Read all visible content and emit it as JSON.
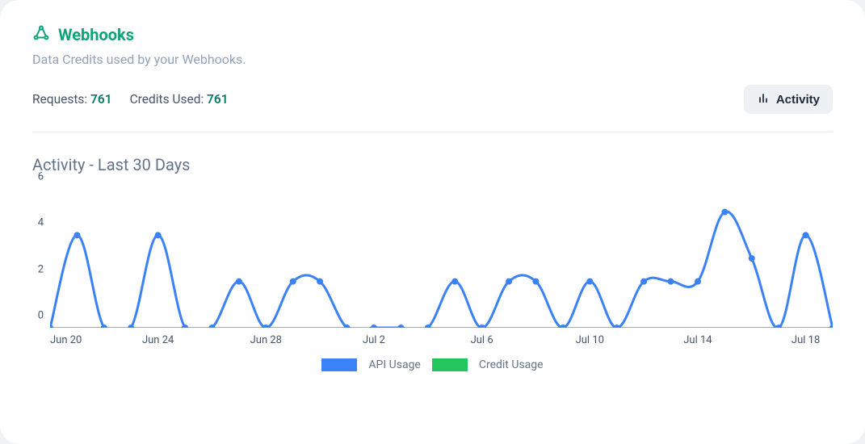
{
  "header": {
    "title": "Webhooks",
    "subtitle": "Data Credits used by your Webhooks."
  },
  "stats": {
    "requests_label": "Requests: ",
    "requests_value": "761",
    "credits_label": "Credits Used: ",
    "credits_value": "761",
    "activity_button": "Activity"
  },
  "chart": {
    "title": "Activity - Last 30 Days",
    "y_ticks": [
      "0",
      "2",
      "4",
      "6"
    ],
    "x_ticks": [
      "Jun 20",
      "Jun 24",
      "Jun 28",
      "Jul 2",
      "Jul 6",
      "Jul 10",
      "Jul 14",
      "Jul 18"
    ],
    "legend": {
      "api": "API Usage",
      "credit": "Credit Usage"
    }
  },
  "colors": {
    "line": "#3b82f6",
    "credit": "#22c55e",
    "baseline": "#475569"
  },
  "chart_data": {
    "type": "line",
    "title": "Activity - Last 30 Days",
    "xlabel": "",
    "ylabel": "",
    "ylim": [
      0,
      6
    ],
    "categories": [
      "Jun 20",
      "Jun 21",
      "Jun 22",
      "Jun 23",
      "Jun 24",
      "Jun 25",
      "Jun 26",
      "Jun 27",
      "Jun 28",
      "Jun 29",
      "Jun 30",
      "Jul 1",
      "Jul 2",
      "Jul 3",
      "Jul 4",
      "Jul 5",
      "Jul 6",
      "Jul 7",
      "Jul 8",
      "Jul 9",
      "Jul 10",
      "Jul 11",
      "Jul 12",
      "Jul 13",
      "Jul 14",
      "Jul 15",
      "Jul 16",
      "Jul 17",
      "Jul 18",
      "Jul 19"
    ],
    "series": [
      {
        "name": "API Usage",
        "values": [
          0,
          4,
          0,
          0,
          4,
          0,
          0,
          2,
          0,
          2,
          2,
          0,
          0,
          0,
          0,
          2,
          0,
          2,
          2,
          0,
          2,
          0,
          2,
          2,
          2,
          5,
          3,
          0,
          4,
          0
        ]
      },
      {
        "name": "Credit Usage",
        "values": [
          0,
          0,
          0,
          0,
          0,
          0,
          0,
          0,
          0,
          0,
          0,
          0,
          0,
          0,
          0,
          0,
          0,
          0,
          0,
          0,
          0,
          0,
          0,
          0,
          0,
          0,
          0,
          0,
          0,
          0
        ]
      }
    ],
    "legend_position": "bottom",
    "grid": false
  }
}
